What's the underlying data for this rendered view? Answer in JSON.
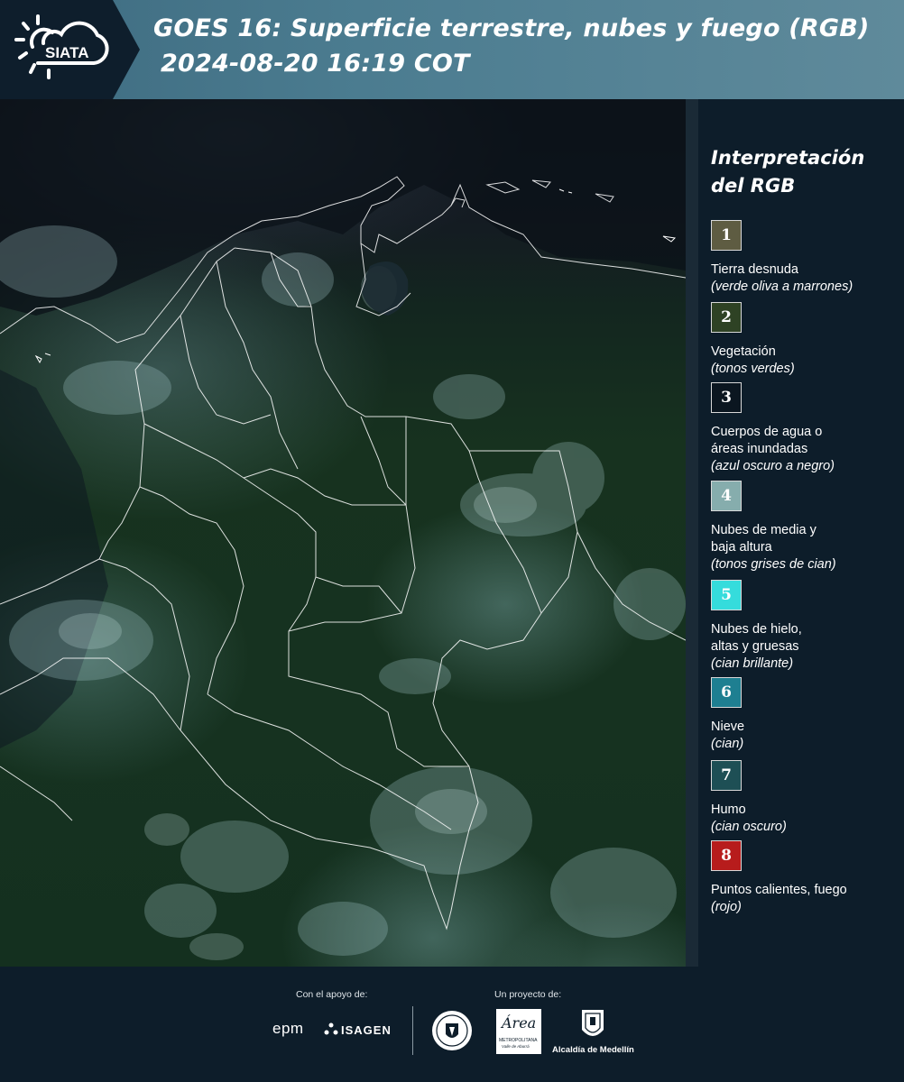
{
  "header": {
    "logo_text": "SIATA",
    "title_line1": "GOES 16: Superficie terrestre, nubes y fuego (RGB)",
    "title_line2": "2024-08-20 16:19 COT"
  },
  "legend": {
    "title_line1": "Interpretación",
    "title_line2": "del RGB",
    "items": [
      {
        "number": "1",
        "color": "#5e5c42",
        "label_lines": [
          "Tierra desnuda"
        ],
        "sub": "(verde oliva a marrones)"
      },
      {
        "number": "2",
        "color": "#2e4224",
        "label_lines": [
          "Vegetación"
        ],
        "sub": "(tonos verdes)"
      },
      {
        "number": "3",
        "color": "#0b1620",
        "label_lines": [
          "Cuerpos de agua o",
          "áreas inundadas"
        ],
        "sub": "(azul oscuro a negro)"
      },
      {
        "number": "4",
        "color": "#86adad",
        "label_lines": [
          "Nubes de media y",
          "baja altura"
        ],
        "sub": "(tonos grises de cian)"
      },
      {
        "number": "5",
        "color": "#35dcdc",
        "label_lines": [
          "Nubes de hielo,",
          "altas y gruesas"
        ],
        "sub": "(cian brillante)"
      },
      {
        "number": "6",
        "color": "#1e7f91",
        "label_lines": [
          "Nieve"
        ],
        "sub": "(cian)"
      },
      {
        "number": "7",
        "color": "#1e4f55",
        "label_lines": [
          "Humo"
        ],
        "sub": "(cian oscuro)"
      },
      {
        "number": "8",
        "color": "#b71c1c",
        "label_lines": [
          "Puntos calientes, fuego"
        ],
        "sub": "(rojo)"
      }
    ]
  },
  "footer": {
    "support_caption": "Con el apoyo de:",
    "project_caption": "Un proyecto de:",
    "sponsor_epm": "epm",
    "sponsor_isagen": "ISAGEN",
    "area_logo_word": "Área",
    "area_logo_sub1": "METROPOLITANA",
    "area_logo_sub2": "Valle de Aburrá",
    "alcaldia": "Alcaldía de Medellín"
  }
}
